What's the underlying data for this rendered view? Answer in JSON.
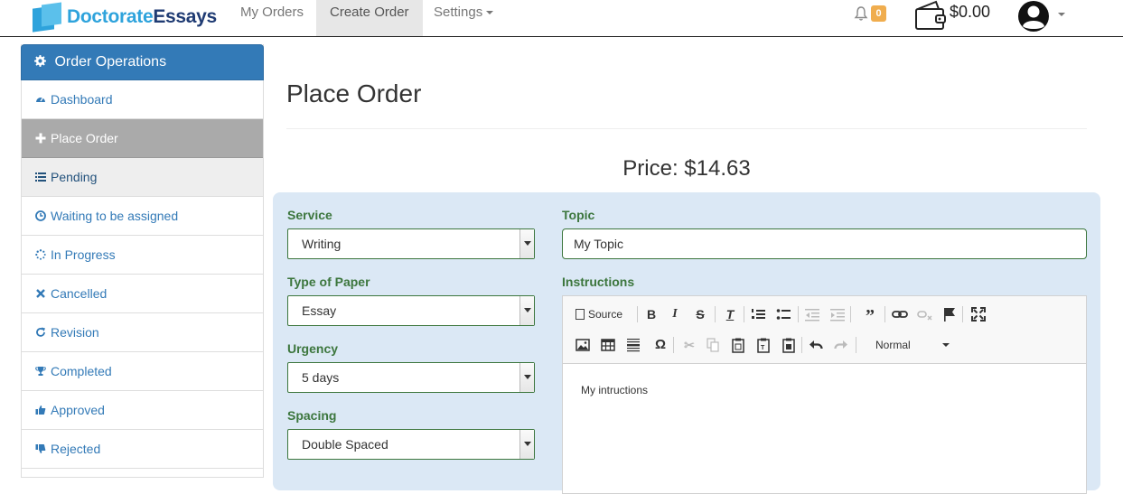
{
  "brand": {
    "part1": "Doctorate",
    "part2": "Essays"
  },
  "nav": {
    "my_orders": "My Orders",
    "create_order": "Create Order",
    "settings": "Settings"
  },
  "header": {
    "notification_count": "0",
    "balance": "$0.00"
  },
  "sidebar": {
    "title": "Order Operations",
    "items": [
      {
        "label": "Dashboard",
        "icon": "dashboard-icon"
      },
      {
        "label": "Place Order",
        "icon": "plus-icon"
      },
      {
        "label": "Pending",
        "icon": "list-icon"
      },
      {
        "label": "Waiting to be assigned",
        "icon": "clock-icon"
      },
      {
        "label": "In Progress",
        "icon": "spinner-icon"
      },
      {
        "label": "Cancelled",
        "icon": "times-icon"
      },
      {
        "label": "Revision",
        "icon": "refresh-icon"
      },
      {
        "label": "Completed",
        "icon": "trophy-icon"
      },
      {
        "label": "Approved",
        "icon": "thumbs-up-icon"
      },
      {
        "label": "Rejected",
        "icon": "thumbs-down-icon"
      }
    ]
  },
  "main": {
    "title": "Place Order",
    "price": "Price: $14.63",
    "form": {
      "service_label": "Service",
      "service_value": "Writing",
      "paper_label": "Type of Paper",
      "paper_value": "Essay",
      "urgency_label": "Urgency",
      "urgency_value": "5 days",
      "spacing_label": "Spacing",
      "spacing_value": "Double Spaced",
      "topic_label": "Topic",
      "topic_value": "My Topic",
      "instructions_label": "Instructions",
      "editor_source_label": "Source",
      "editor_format_value": "Normal",
      "instructions_value": "My intructions"
    }
  },
  "colors": {
    "primary": "#337ab7",
    "success": "#3c763d",
    "panel": "#dbe8f5",
    "badge": "#f0ad4e"
  }
}
